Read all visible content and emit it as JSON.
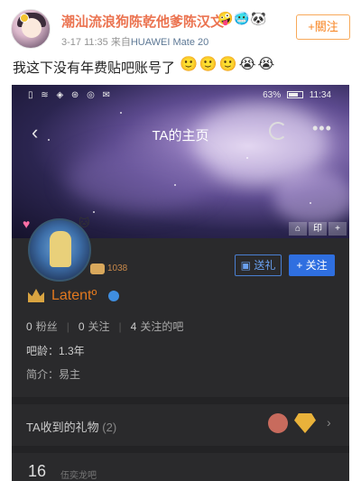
{
  "post": {
    "user_name": "潮汕流浪狗陈乾他爹陈汉文",
    "name_emojis": "🤪🥶🐼",
    "time": "3-17 11:35",
    "source_prefix": "来自",
    "source": "HUAWEI Mate 20",
    "follow_label": "+關注",
    "text": "我这下没有年费贴吧账号了",
    "text_emojis": "🙂🙂🙂😭😭"
  },
  "screenshot": {
    "status_left": "▯ ≋ ◈ ⊛ ◎ ✉",
    "battery_pct": "63%",
    "clock": "11:34",
    "back_icon": "‹",
    "title": "TA的主页",
    "more_icon": "•••",
    "banner_tools": [
      "⌂",
      "印",
      "+"
    ],
    "level": "1038",
    "gift_button": "▣ 送礼",
    "follow_button": "+ 关注",
    "profile_name": "Latentº",
    "counts": [
      {
        "n": "0",
        "label": "粉丝"
      },
      {
        "n": "0",
        "label": "关注"
      },
      {
        "n": "4",
        "label": "关注的吧"
      }
    ],
    "bar_age": "吧龄：1.3年",
    "intro": "简介：易主",
    "gifts_label": "TA收到的礼物",
    "gifts_count": "(2)",
    "chevron": "›",
    "bottom_num": "16",
    "bottom_label": "伍奕龙吧"
  }
}
